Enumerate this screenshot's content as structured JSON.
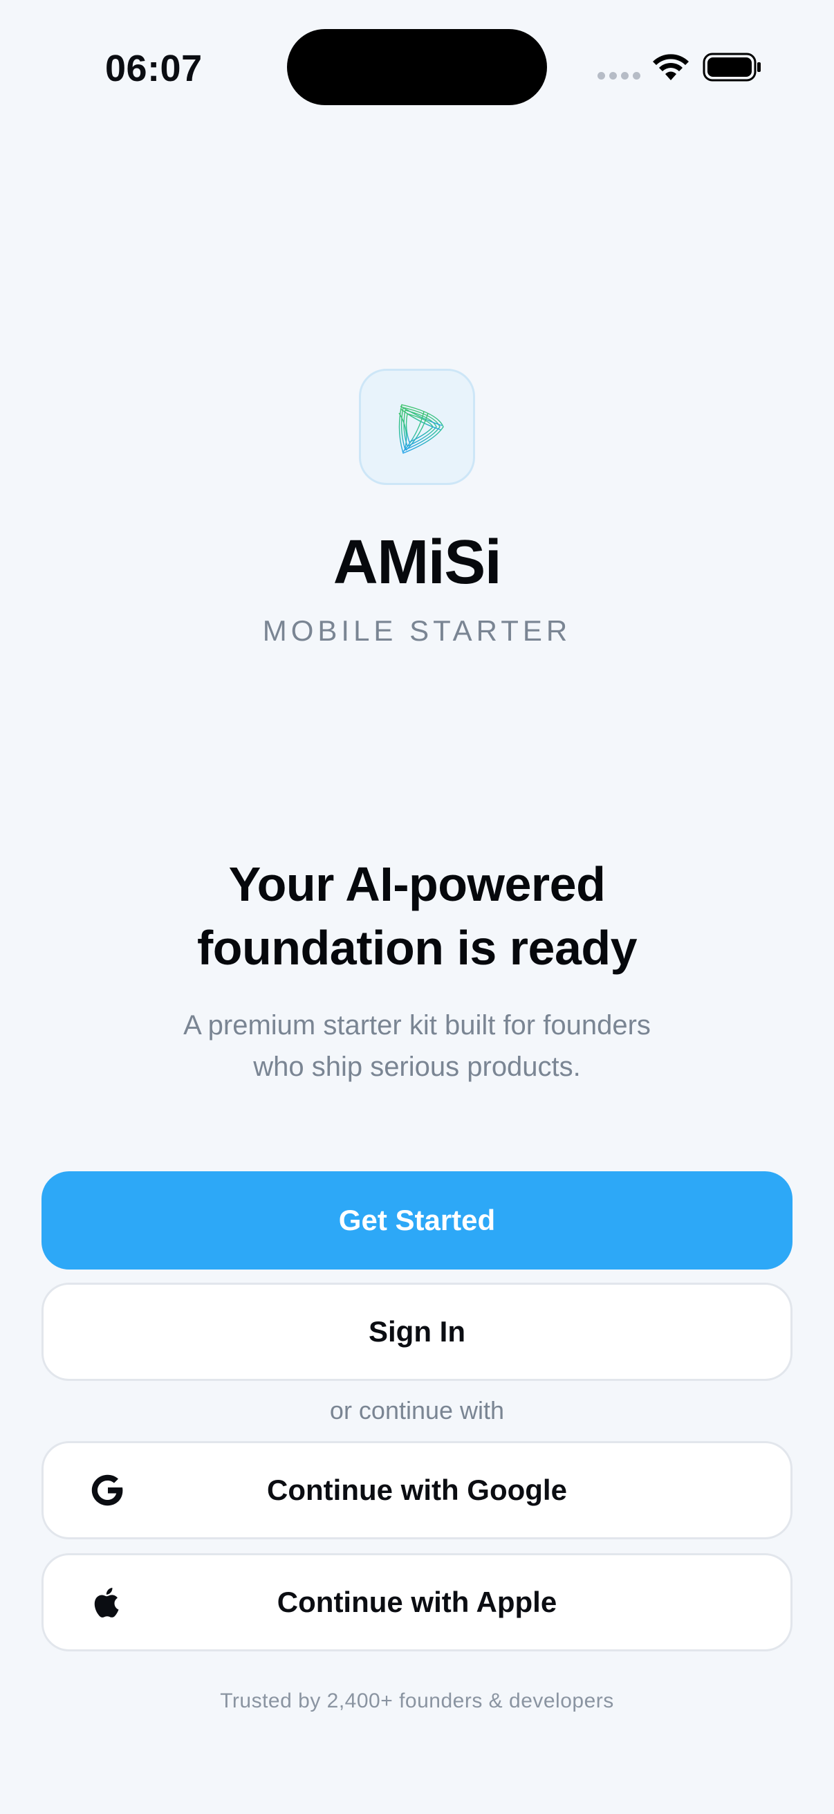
{
  "status_bar": {
    "time": "06:07",
    "icons": [
      "cellular-signal-icon",
      "wifi-icon",
      "battery-icon"
    ]
  },
  "brand": {
    "logo": "amisi-logo-icon",
    "name": "AMiSi",
    "tagline": "MOBILE STARTER"
  },
  "hero": {
    "headline_line1": "Your AI-powered",
    "headline_line2": "foundation is ready",
    "subline_line1": "A premium starter kit built for founders",
    "subline_line2": "who ship serious products."
  },
  "actions": {
    "get_started_label": "Get Started",
    "sign_in_label": "Sign In",
    "divider_label": "or continue with",
    "google_label": "Continue with Google",
    "apple_label": "Continue with Apple"
  },
  "footer": {
    "trust_text": "Trusted by 2,400+ founders & developers"
  },
  "colors": {
    "background": "#f4f7fb",
    "primary": "#2da8f7",
    "muted_text": "#7a8593",
    "button_border": "#e2e6ec"
  }
}
